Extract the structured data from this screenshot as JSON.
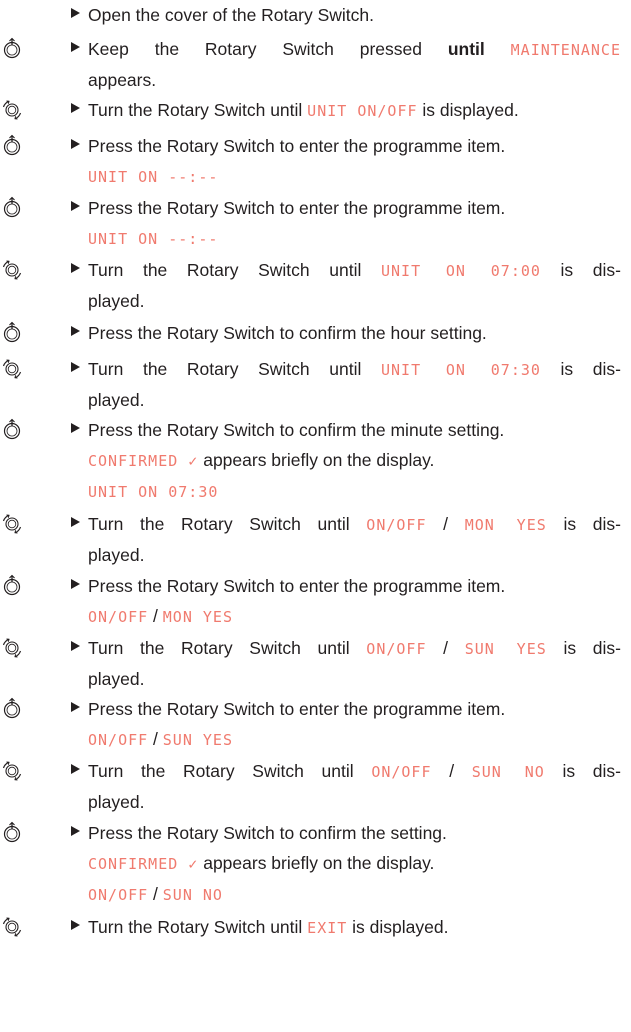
{
  "steps": [
    {
      "icon": "none",
      "lines": [
        [
          {
            "t": "Open the cover of the Rotary Switch."
          }
        ]
      ]
    },
    {
      "icon": "press",
      "lines": [
        [
          {
            "t": "Keep the Rotary Switch pressed "
          },
          {
            "t": "until",
            "b": true
          },
          {
            "t": " "
          },
          {
            "t": "MAINTENANCE",
            "d": true
          }
        ],
        [
          {
            "t": "appears."
          }
        ]
      ],
      "justify": true
    },
    {
      "icon": "turn",
      "lines": [
        [
          {
            "t": "Turn the Rotary Switch until "
          },
          {
            "t": "UNIT ON/OFF",
            "d": true
          },
          {
            "t": " is displayed."
          }
        ]
      ]
    },
    {
      "icon": "press",
      "lines": [
        [
          {
            "t": "Press the Rotary Switch to enter the programme item."
          }
        ],
        [
          {
            "t": "UNIT ON --:--",
            "d": true
          }
        ]
      ]
    },
    {
      "icon": "press",
      "lines": [
        [
          {
            "t": "Press the Rotary Switch to enter the programme item."
          }
        ],
        [
          {
            "t": "UNIT ON --:--",
            "d": true
          }
        ]
      ]
    },
    {
      "icon": "turn",
      "lines": [
        [
          {
            "t": "Turn the Rotary Switch until "
          },
          {
            "t": "UNIT ON 07:00",
            "d": true
          },
          {
            "t": " is dis-"
          }
        ],
        [
          {
            "t": "played."
          }
        ]
      ],
      "justify": true
    },
    {
      "icon": "press",
      "lines": [
        [
          {
            "t": "Press the Rotary Switch to confirm the hour setting."
          }
        ]
      ]
    },
    {
      "icon": "turn",
      "lines": [
        [
          {
            "t": "Turn the Rotary Switch until "
          },
          {
            "t": "UNIT ON 07:30",
            "d": true
          },
          {
            "t": " is dis-"
          }
        ],
        [
          {
            "t": "played."
          }
        ]
      ],
      "justify": true
    },
    {
      "icon": "press",
      "lines": [
        [
          {
            "t": "Press the Rotary Switch to confirm the minute setting."
          }
        ],
        [
          {
            "t": "CONFIRMED ✓",
            "d": true
          },
          {
            "t": " appears briefly on the display."
          }
        ],
        [
          {
            "t": "UNIT ON 07:30",
            "d": true
          }
        ]
      ]
    },
    {
      "icon": "turn",
      "lines": [
        [
          {
            "t": "Turn the Rotary Switch until "
          },
          {
            "t": "ON/OFF",
            "d": true
          },
          {
            "t": " / ",
            "s": true
          },
          {
            "t": "MON YES",
            "d": true
          },
          {
            "t": " is dis-"
          }
        ],
        [
          {
            "t": "played."
          }
        ]
      ],
      "justify": true
    },
    {
      "icon": "press",
      "lines": [
        [
          {
            "t": "Press the Rotary Switch to enter the programme item."
          }
        ],
        [
          {
            "t": "ON/OFF",
            "d": true
          },
          {
            "t": " / ",
            "s": true
          },
          {
            "t": "MON YES",
            "d": true
          }
        ]
      ]
    },
    {
      "icon": "turn",
      "lines": [
        [
          {
            "t": "Turn the Rotary Switch until "
          },
          {
            "t": "ON/OFF",
            "d": true
          },
          {
            "t": " / ",
            "s": true
          },
          {
            "t": "SUN YES",
            "d": true
          },
          {
            "t": " is dis-"
          }
        ],
        [
          {
            "t": "played."
          }
        ]
      ],
      "justify": true
    },
    {
      "icon": "press",
      "lines": [
        [
          {
            "t": "Press the Rotary Switch to enter the programme item."
          }
        ],
        [
          {
            "t": "ON/OFF",
            "d": true
          },
          {
            "t": " / ",
            "s": true
          },
          {
            "t": "SUN YES",
            "d": true
          }
        ]
      ]
    },
    {
      "icon": "turn",
      "lines": [
        [
          {
            "t": "Turn the Rotary Switch until "
          },
          {
            "t": "ON/OFF",
            "d": true
          },
          {
            "t": " / ",
            "s": true
          },
          {
            "t": "SUN NO",
            "d": true
          },
          {
            "t": " is dis-"
          }
        ],
        [
          {
            "t": "played."
          }
        ]
      ],
      "justify": true
    },
    {
      "icon": "press",
      "lines": [
        [
          {
            "t": "Press the Rotary Switch to confirm the setting."
          }
        ],
        [
          {
            "t": "CONFIRMED ✓",
            "d": true
          },
          {
            "t": " appears briefly on the display."
          }
        ],
        [
          {
            "t": "ON/OFF",
            "d": true
          },
          {
            "t": " / ",
            "s": true
          },
          {
            "t": "SUN NO",
            "d": true
          }
        ]
      ]
    },
    {
      "icon": "turn",
      "lines": [
        [
          {
            "t": "Turn the Rotary Switch until "
          },
          {
            "t": "EXIT",
            "d": true
          },
          {
            "t": " is displayed."
          }
        ]
      ]
    }
  ],
  "icon_names": {
    "press": "press-knob-icon",
    "turn": "turn-knob-icon"
  },
  "colors": {
    "display_text": "#f07a6e",
    "body_text": "#231f20"
  }
}
